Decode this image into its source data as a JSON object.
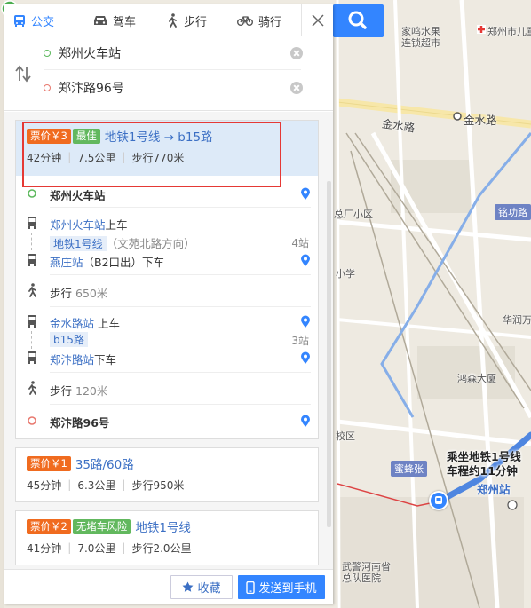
{
  "tabs": [
    {
      "label": "公交",
      "icon": "bus-icon"
    },
    {
      "label": "驾车",
      "icon": "car-icon"
    },
    {
      "label": "步行",
      "icon": "walk-icon"
    },
    {
      "label": "骑行",
      "icon": "bike-icon"
    }
  ],
  "route": {
    "origin": "郑州火车站",
    "destination": "郑汴路96号"
  },
  "plans": [
    {
      "price": "票价￥3",
      "badge": "最佳",
      "lines": "地铁1号线 → b15路",
      "time": "42分钟",
      "distance": "7.5公里",
      "walk": "步行770米"
    },
    {
      "price": "票价￥1",
      "badge": "",
      "lines": "35路/60路",
      "time": "45分钟",
      "distance": "6.3公里",
      "walk": "步行950米"
    },
    {
      "price": "票价￥2",
      "badge": "无堵车风险",
      "lines": "地铁1号线",
      "time": "41分钟",
      "distance": "7.0公里",
      "walk": "步行2.0公里"
    }
  ],
  "steps": {
    "start": "郑州火车站",
    "s1_station": "郑州火车站",
    "s1_action": "上车",
    "s1_line": "地铁1号线",
    "s1_dir": "（文苑北路方向）",
    "s1_count": "4站",
    "s1_off_station": "燕庄站",
    "s1_off_detail": "（B2口出）",
    "s1_off_action": "下车",
    "walk1": "步行",
    "walk1_dist": "650米",
    "s2_station": "金水路站",
    "s2_action": "上车",
    "s2_line": "b15路",
    "s2_count": "3站",
    "s2_off_station": "郑汴路站",
    "s2_off_action": "下车",
    "walk2": "步行",
    "walk2_dist": "120米",
    "end": "郑汴路96号"
  },
  "actions": {
    "favorite": "收藏",
    "send": "发送到手机"
  },
  "map": {
    "labels": {
      "l1": "家鸣水果",
      "l2": "连锁超市",
      "l3": "郑州市儿童",
      "road1": "金水路",
      "station1": "金水路",
      "l4": "总厂小区",
      "l5": "小学",
      "l6": "华润万象",
      "l7": "鸿森大厦",
      "l8": "校区",
      "l9": "武警河南省",
      "l10": "总队医院",
      "road2": "铭功路",
      "road3": "蜜蜂张",
      "zz": "郑州站"
    },
    "callout": {
      "line1": "乘坐地铁1号线",
      "line2": "车程约11分钟"
    },
    "start_marker": "起"
  },
  "colors": {
    "accent": "#3385ff",
    "price": "#f06b1f",
    "best": "#62b85e",
    "highlight": "#e53935"
  }
}
